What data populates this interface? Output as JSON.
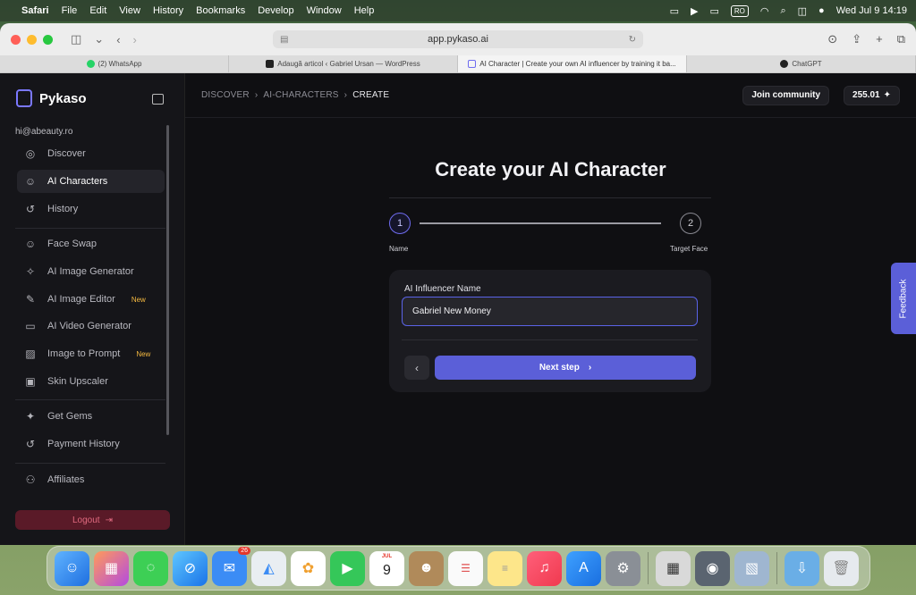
{
  "menubar": {
    "app": "Safari",
    "menus": [
      "File",
      "Edit",
      "View",
      "History",
      "Bookmarks",
      "Develop",
      "Window",
      "Help"
    ],
    "input_source": "RO",
    "datetime": "Wed Jul 9  14:19"
  },
  "browser": {
    "url": "app.pykaso.ai",
    "tabs": [
      {
        "label": "(2) WhatsApp",
        "color": "#25d366"
      },
      {
        "label": "Adaugă articol ‹ Gabriel Ursan — WordPress",
        "color": "#222222"
      },
      {
        "label": "AI Character | Create your own AI influencer by training it ba...",
        "color": "#6f6cf0"
      },
      {
        "label": "ChatGPT",
        "color": "#222222"
      }
    ]
  },
  "sidebar": {
    "brand": "Pykaso",
    "email": "hi@abeauty.ro",
    "items": [
      {
        "label": "Discover",
        "icon": "compass-icon",
        "new": ""
      },
      {
        "label": "AI Characters",
        "icon": "character-icon",
        "new": ""
      },
      {
        "label": "History",
        "icon": "history-icon",
        "new": ""
      },
      {
        "label": "Face Swap",
        "icon": "face-swap-icon",
        "new": ""
      },
      {
        "label": "AI Image Generator",
        "icon": "magic-wand-icon",
        "new": ""
      },
      {
        "label": "AI Image Editor",
        "icon": "edit-icon",
        "new": "New"
      },
      {
        "label": "AI Video Generator",
        "icon": "video-icon",
        "new": ""
      },
      {
        "label": "Image to Prompt",
        "icon": "image-prompt-icon",
        "new": "New"
      },
      {
        "label": "Skin Upscaler",
        "icon": "upscale-icon",
        "new": ""
      },
      {
        "label": "Get Gems",
        "icon": "gem-icon",
        "new": ""
      },
      {
        "label": "Payment History",
        "icon": "history-icon",
        "new": ""
      },
      {
        "label": "Affiliates",
        "icon": "affiliate-icon",
        "new": ""
      }
    ],
    "logout_label": "Logout"
  },
  "topbar": {
    "crumbs": [
      "DISCOVER",
      "AI-CHARACTERS",
      "CREATE"
    ],
    "join_label": "Join community",
    "credits": "255.01"
  },
  "main": {
    "title": "Create your AI Character",
    "steps": [
      {
        "number": "1",
        "label": "Name"
      },
      {
        "number": "2",
        "label": "Target Face"
      }
    ],
    "field_label": "AI Influencer Name",
    "field_value": "Gabriel New Money",
    "next_label": "Next step"
  },
  "feedback_label": "Feedback",
  "dock": {
    "calendar_month": "JUL",
    "calendar_day": "9",
    "mail_badge": "26"
  },
  "colors": {
    "accent": "#5b5fd8",
    "new_badge": "#f5b940",
    "logout_bg": "#5a1a28"
  }
}
